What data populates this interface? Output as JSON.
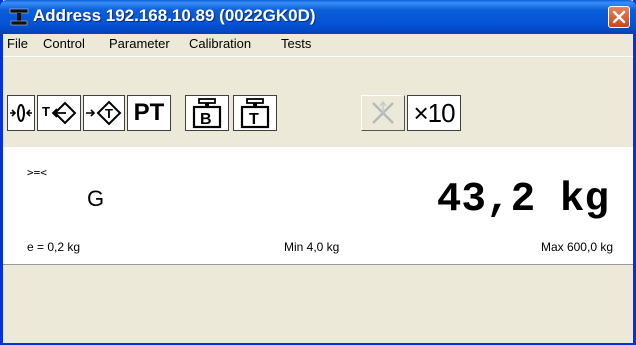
{
  "window": {
    "title": "Address 192.168.10.89 (0022GK0D)"
  },
  "menu": [
    {
      "label": "File"
    },
    {
      "label": "Control"
    },
    {
      "label": "Parameter"
    },
    {
      "label": "Calibration"
    },
    {
      "label": "Tests"
    }
  ],
  "toolbar": {
    "buttons": [
      {
        "icon": "zero-icon"
      },
      {
        "icon": "tare-icon"
      },
      {
        "icon": "clear-tare-icon"
      },
      {
        "label": "PT",
        "icon": "preset-tare-text"
      },
      {
        "label": "B",
        "icon": "gross-weight-icon"
      },
      {
        "label": "T",
        "icon": "tare-weight-icon"
      },
      {
        "icon": "disabled-x-icon"
      },
      {
        "label": "×10",
        "icon": "times-ten-icon"
      }
    ]
  },
  "display": {
    "indicator": ">=<",
    "mode": "G",
    "weight": "43,2 kg",
    "division": "e = 0,2 kg",
    "min": "Min 4,0 kg",
    "max": "Max 600,0 kg"
  },
  "colors": {
    "title_bar": "#0a5fd8",
    "close_button": "#d4542a",
    "background": "#ece9d8"
  }
}
